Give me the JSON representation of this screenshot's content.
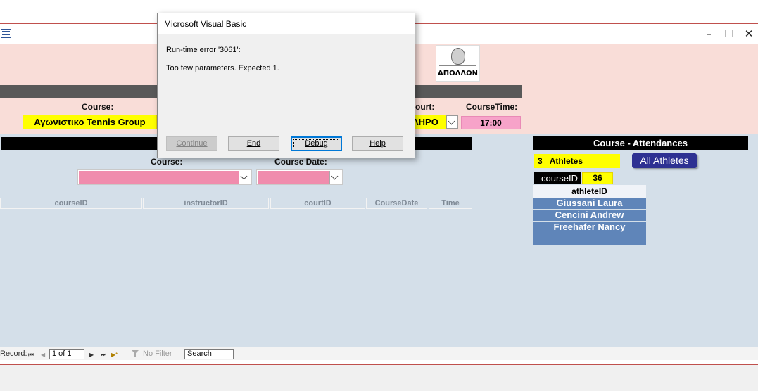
{
  "window": {
    "minimize_glyph": "–",
    "maximize_glyph": "☐",
    "close_glyph": "✕"
  },
  "logo": {
    "text": "ΑΠΟΛΛΩΝ"
  },
  "header": {
    "course_label": "Course:",
    "course_value": "Αγωνιστικο Tennis Group",
    "court_label": "ourt:",
    "court_value": "ΛΗΡΟ",
    "coursetime_label": "CourseTime:",
    "coursetime_value": "17:00"
  },
  "filters": {
    "course_label": "Course:",
    "course_date_label": "Course Date:"
  },
  "table": {
    "columns": [
      "courseID",
      "instructorID",
      "courtID",
      "CourseDate",
      "Time"
    ]
  },
  "attendances": {
    "title": "Course - Attendances",
    "athletes_count": "3",
    "athletes_label": "Athletes",
    "all_athletes_button": "All Athletes",
    "courseid_label": "courseID",
    "courseid_value": "36",
    "athlete_column": "athleteID",
    "athletes": [
      "Giussani Laura",
      "Cencini Andrew",
      "Freehafer Nancy",
      ""
    ]
  },
  "navigator": {
    "record_label": "Record:",
    "first_glyph": "⏮",
    "prev_glyph": "◀",
    "position": "1 of 1",
    "next_glyph": "▶",
    "last_glyph": "⏭",
    "new_glyph": "▶*",
    "no_filter": "No Filter",
    "search": "Search"
  },
  "dialog": {
    "title": "Microsoft Visual Basic",
    "error_line": "Run-time error '3061':",
    "message": "Too few parameters. Expected 1.",
    "buttons": {
      "continue": "Continue",
      "end": "End",
      "debug": "Debug",
      "help": "Help"
    }
  }
}
